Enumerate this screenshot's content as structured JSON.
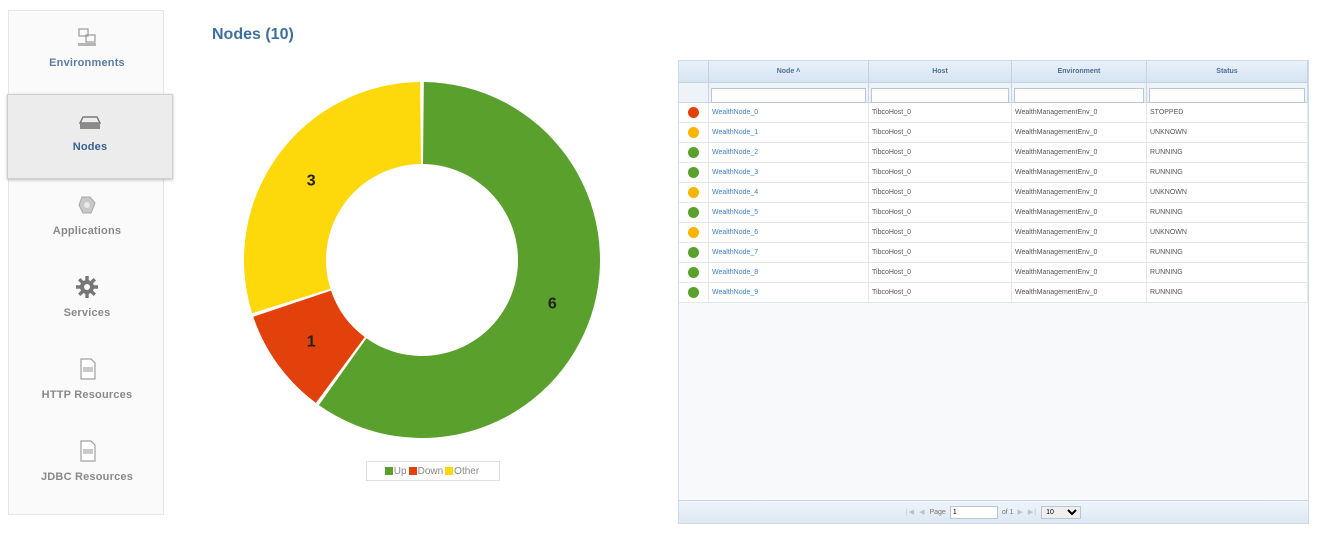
{
  "sidebar": {
    "items": [
      {
        "label": "Environments",
        "icon": "environments-icon"
      },
      {
        "label": "Nodes",
        "icon": "nodes-icon"
      },
      {
        "label": "Applications",
        "icon": "applications-icon"
      },
      {
        "label": "Services",
        "icon": "gear-icon"
      },
      {
        "label": "HTTP Resources",
        "icon": "http-resource-icon"
      },
      {
        "label": "JDBC Resources",
        "icon": "jdbc-resource-icon"
      }
    ],
    "active": "Nodes"
  },
  "page": {
    "title": "Nodes (10)"
  },
  "chart_data": {
    "type": "donut",
    "categories": [
      "Up",
      "Down",
      "Other"
    ],
    "values": [
      6,
      1,
      3
    ],
    "colors": [
      "#5aa02c",
      "#e2410b",
      "#fdd80a"
    ],
    "legend": "bottom"
  },
  "legend": {
    "items": [
      {
        "label": "Up",
        "color": "#5aa02c"
      },
      {
        "label": "Down",
        "color": "#e2410b"
      },
      {
        "label": "Other",
        "color": "#fdd80a"
      }
    ]
  },
  "grid": {
    "columns": [
      "Node",
      "Host",
      "Environment",
      "Status"
    ],
    "rows": [
      {
        "state_color": "#e2410b",
        "node": "WealthNode_0",
        "host": "TibcoHost_0",
        "environment": "WealthManagementEnv_0",
        "status": "STOPPED"
      },
      {
        "state_color": "#f7b500",
        "node": "WealthNode_1",
        "host": "TibcoHost_0",
        "environment": "WealthManagementEnv_0",
        "status": "UNKNOWN"
      },
      {
        "state_color": "#5aa02c",
        "node": "WealthNode_2",
        "host": "TibcoHost_0",
        "environment": "WealthManagementEnv_0",
        "status": "RUNNING"
      },
      {
        "state_color": "#5aa02c",
        "node": "WealthNode_3",
        "host": "TibcoHost_0",
        "environment": "WealthManagementEnv_0",
        "status": "RUNNING"
      },
      {
        "state_color": "#f7b500",
        "node": "WealthNode_4",
        "host": "TibcoHost_0",
        "environment": "WealthManagementEnv_0",
        "status": "UNKNOWN"
      },
      {
        "state_color": "#5aa02c",
        "node": "WealthNode_5",
        "host": "TibcoHost_0",
        "environment": "WealthManagementEnv_0",
        "status": "RUNNING"
      },
      {
        "state_color": "#f7b500",
        "node": "WealthNode_6",
        "host": "TibcoHost_0",
        "environment": "WealthManagementEnv_0",
        "status": "UNKNOWN"
      },
      {
        "state_color": "#5aa02c",
        "node": "WealthNode_7",
        "host": "TibcoHost_0",
        "environment": "WealthManagementEnv_0",
        "status": "RUNNING"
      },
      {
        "state_color": "#5aa02c",
        "node": "WealthNode_8",
        "host": "TibcoHost_0",
        "environment": "WealthManagementEnv_0",
        "status": "RUNNING"
      },
      {
        "state_color": "#5aa02c",
        "node": "WealthNode_9",
        "host": "TibcoHost_0",
        "environment": "WealthManagementEnv_0",
        "status": "RUNNING"
      }
    ]
  },
  "pager": {
    "page_label": "Page",
    "page_value": "1",
    "of_label": "of 1",
    "rows_per_page": "10"
  }
}
